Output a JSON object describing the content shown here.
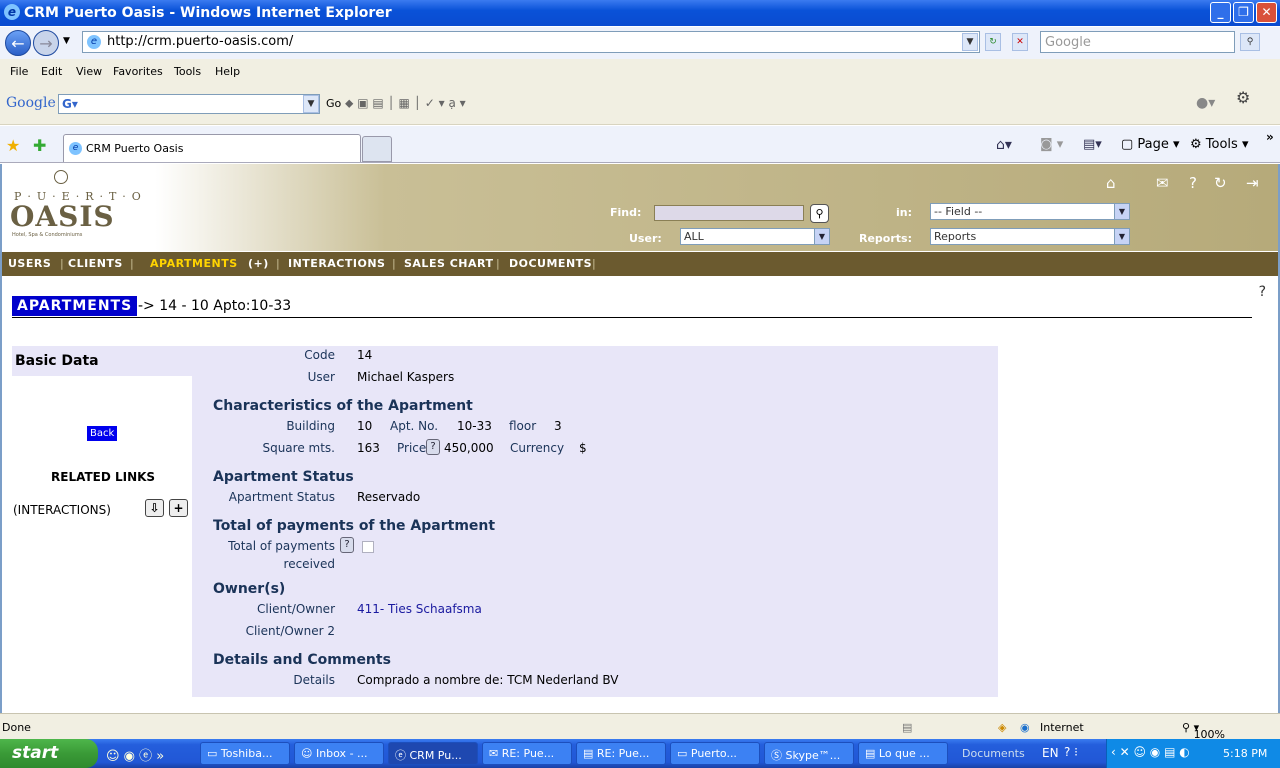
{
  "window": {
    "title": "CRM Puerto Oasis - Windows Internet Explorer"
  },
  "address": {
    "url": "http://crm.puerto-oasis.com/",
    "search_placeholder": "Google"
  },
  "menu": [
    "File",
    "Edit",
    "View",
    "Favorites",
    "Tools",
    "Help"
  ],
  "gbar": {
    "brand": "Google",
    "go": "Go"
  },
  "tabs": {
    "active": "CRM Puerto Oasis",
    "page_label": "Page",
    "tools_label": "Tools"
  },
  "logo": {
    "top": "P·U·E·R·T·O",
    "main": "OASIS",
    "sub": "Hotel, Spa & Condominiums"
  },
  "header": {
    "find_label": "Find:",
    "in_label": "in:",
    "user_label": "User:",
    "reports_label": "Reports:",
    "field_value": "-- Field --",
    "user_value": "ALL",
    "reports_value": "Reports"
  },
  "nav": [
    "USERS",
    "CLIENTS",
    "APARTMENTS",
    "(+)",
    "INTERACTIONS",
    "SALES CHART",
    "DOCUMENTS"
  ],
  "crumb": {
    "section": "APARTMENTS",
    "path": "-> 14 - 10 Apto:10-33"
  },
  "left": {
    "basic_data": "Basic Data",
    "back": "Back",
    "related_links": "RELATED LINKS",
    "interactions": "(INTERACTIONS)"
  },
  "record": {
    "code_label": "Code",
    "code": "14",
    "user_label": "User",
    "user": "Michael Kaspers",
    "sect_char": "Characteristics of the Apartment",
    "building_label": "Building",
    "building": "10",
    "aptno_label": "Apt. No.",
    "aptno": "10-33",
    "floor_label": "floor",
    "floor": "3",
    "sqm_label": "Square mts.",
    "sqm": "163",
    "price_label": "Price",
    "price": "450,000",
    "currency_label": "Currency",
    "currency": "$",
    "sect_status": "Apartment Status",
    "status_label": "Apartment Status",
    "status": "Reservado",
    "sect_payments": "Total of payments of the Apartment",
    "payments_label1": "Total of payments",
    "payments_label2": "received",
    "sect_owner": "Owner(s)",
    "owner_label": "Client/Owner",
    "owner": "411- Ties Schaafsma",
    "owner2_label": "Client/Owner 2",
    "sect_details": "Details and Comments",
    "details_label": "Details",
    "details": "Comprado a nombre de: TCM Nederland BV"
  },
  "status": {
    "left": "Done",
    "zone": "Internet",
    "zoom": "100%"
  },
  "taskbar": {
    "start": "start",
    "items": [
      "Toshiba...",
      "Inbox - ...",
      "CRM Pu...",
      "RE: Pue...",
      "RE: Pue...",
      "Puerto...",
      "Skype™...",
      "Lo que ...",
      "Documents"
    ],
    "lang": "EN",
    "time": "5:18 PM"
  }
}
